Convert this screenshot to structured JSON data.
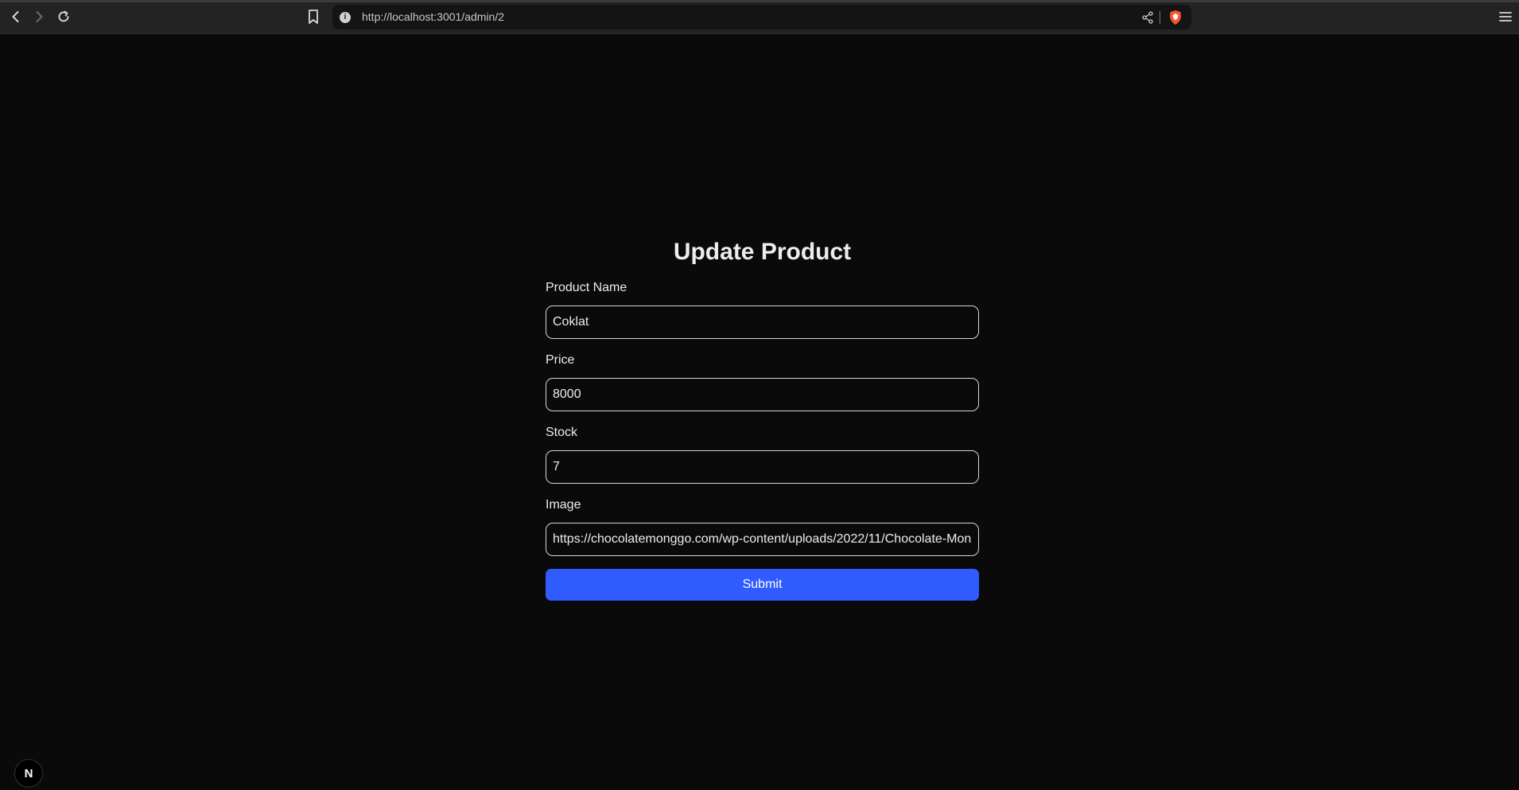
{
  "browser": {
    "url": "http://localhost:3001/admin/2",
    "info_glyph": "i",
    "icons": [
      "back-arrow-icon",
      "forward-arrow-icon",
      "reload-icon",
      "bookmark-icon",
      "info-icon",
      "share-icon",
      "brave-shield-icon",
      "hamburger-menu-icon"
    ]
  },
  "form": {
    "title": "Update Product",
    "fields": [
      {
        "label": "Product Name",
        "value": "Coklat"
      },
      {
        "label": "Price",
        "value": "8000"
      },
      {
        "label": "Stock",
        "value": "7"
      },
      {
        "label": "Image",
        "value": "https://chocolatemonggo.com/wp-content/uploads/2022/11/Chocolate-Mon"
      }
    ],
    "submit_label": "Submit"
  },
  "badge": {
    "glyph": "N"
  },
  "colors": {
    "background": "#0a0a0a",
    "accent": "#2f5bff",
    "input_border": "#d4d4d4"
  }
}
